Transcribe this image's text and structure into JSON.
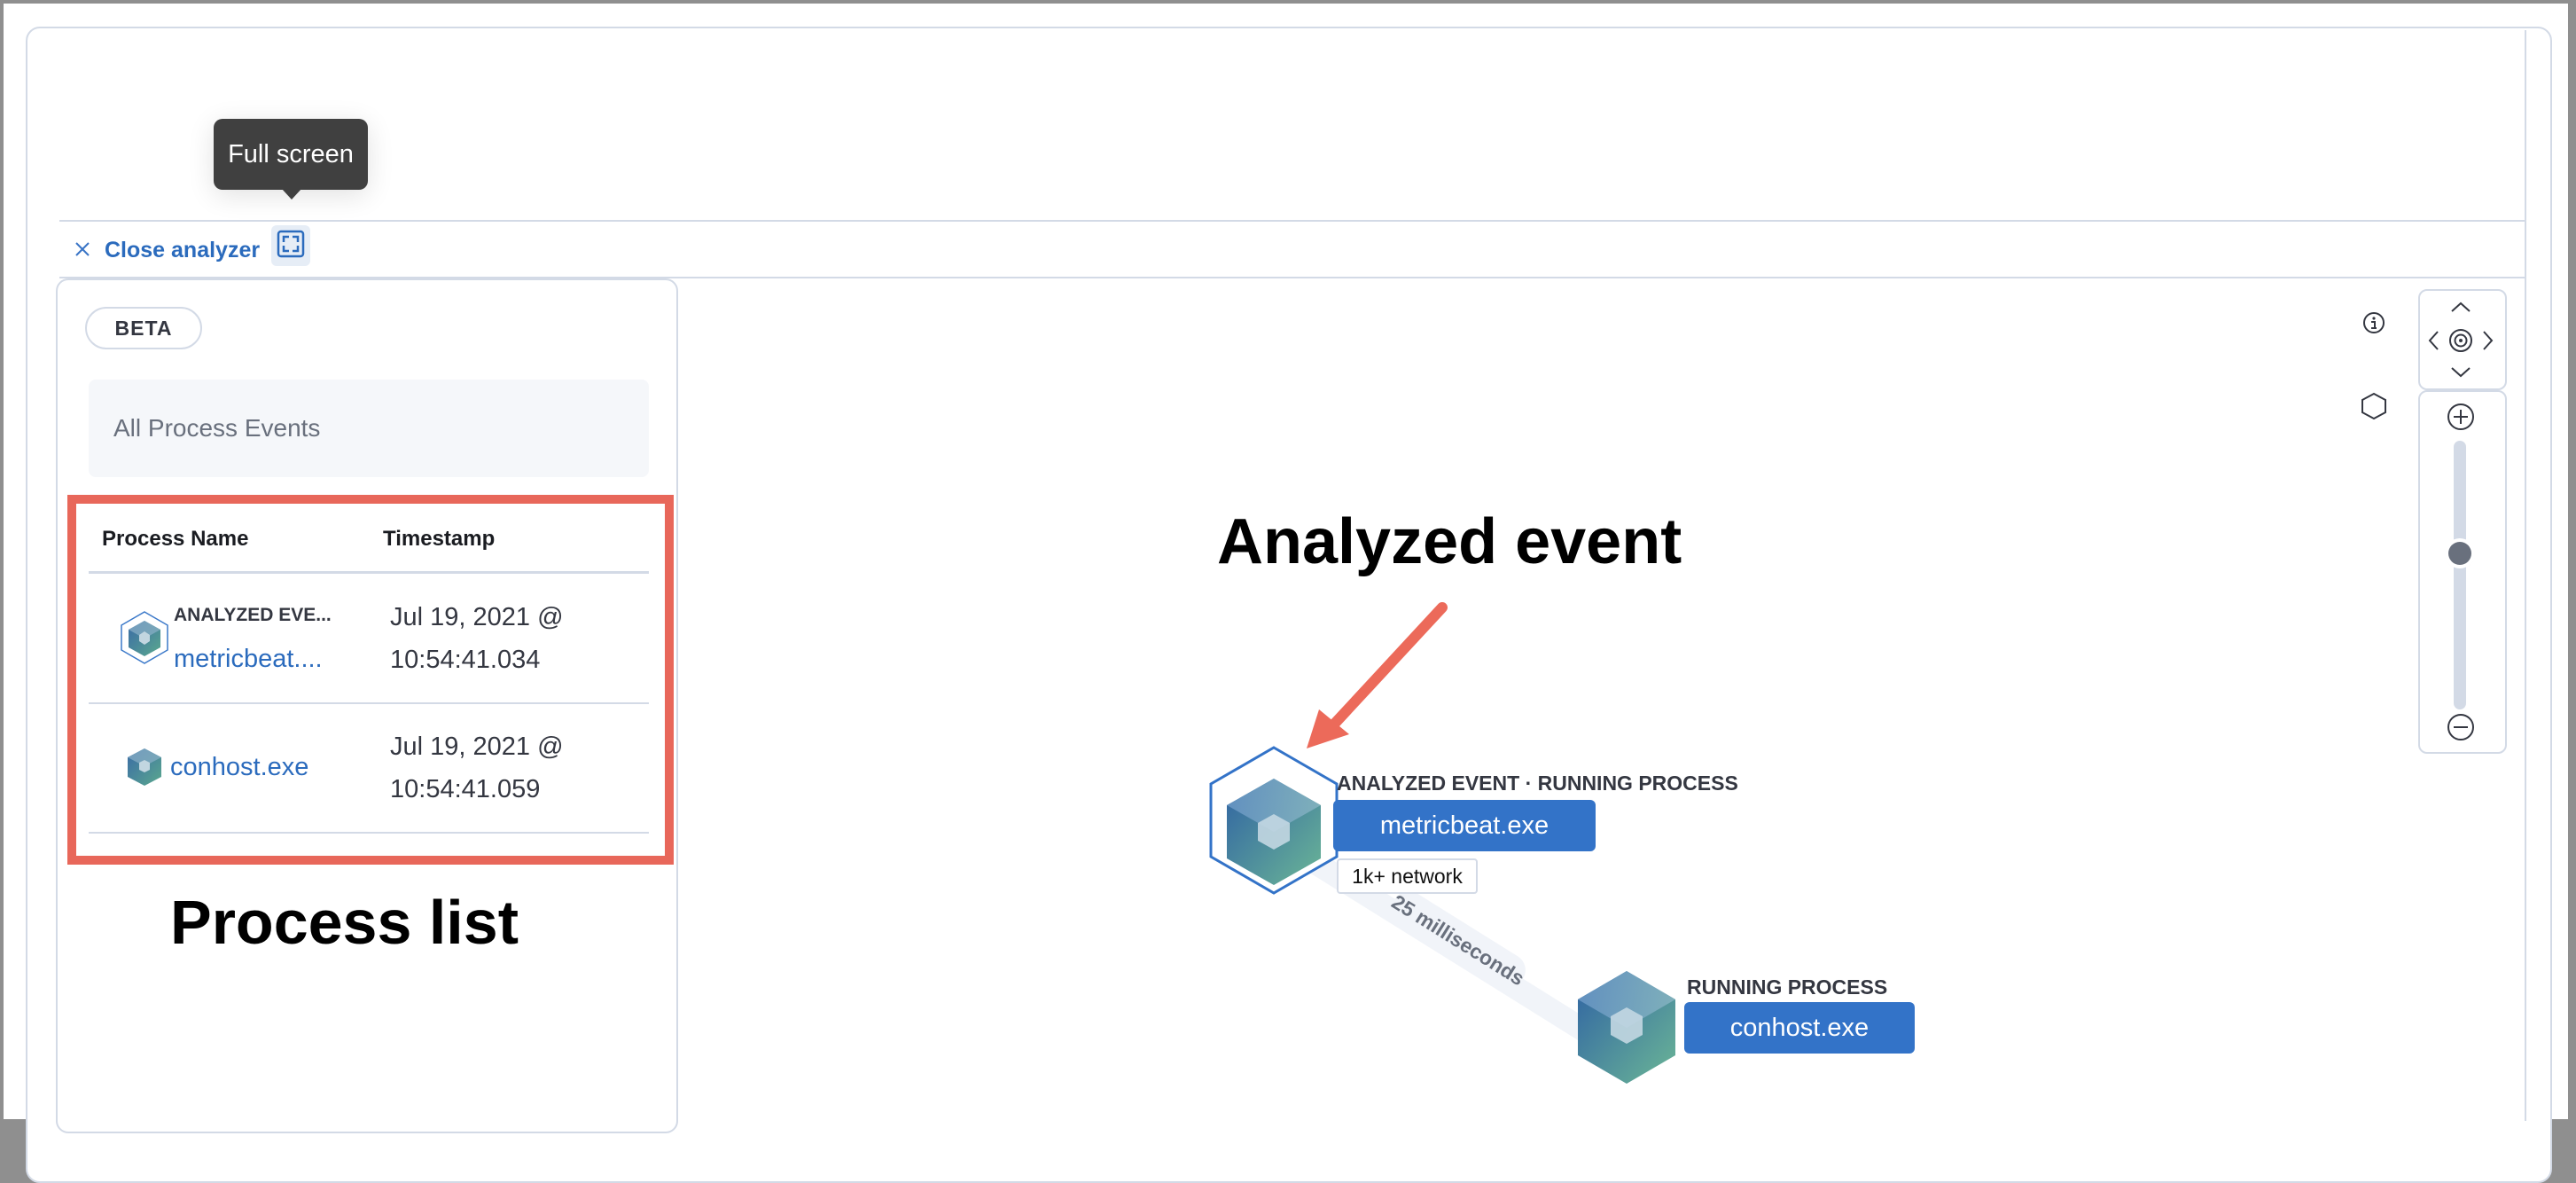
{
  "tooltip": {
    "text": "Full screen"
  },
  "toolbar": {
    "close_icon": "close-icon",
    "close_label": "Close analyzer",
    "fullscreen_icon": "fullscreen-icon"
  },
  "panel": {
    "badge": "BETA",
    "breadcrumb": "All Process Events",
    "table": {
      "columns": [
        "Process Name",
        "Timestamp"
      ],
      "rows": [
        {
          "tag": "ANALYZED EVE...",
          "name": "metricbeat....",
          "icon": "analyzed-process-cube-icon",
          "timestamp_date": "Jul 19, 2021 @",
          "timestamp_time": "10:54:41.034"
        },
        {
          "tag": "",
          "name": "conhost.exe",
          "icon": "process-cube-icon",
          "timestamp_date": "Jul 19, 2021 @",
          "timestamp_time": "10:54:41.059"
        }
      ]
    }
  },
  "annotations": {
    "process_list": "Process list",
    "analyzed_event": "Analyzed event",
    "highlight_color": "#E8675A"
  },
  "graph": {
    "nodes": [
      {
        "label": "ANALYZED EVENT · RUNNING PROCESS",
        "name": "metricbeat.exe",
        "badge": "1k+ network",
        "analyzed": true
      },
      {
        "label": "RUNNING PROCESS",
        "name": "conhost.exe",
        "analyzed": false
      }
    ],
    "edge": {
      "label": "25 milliseconds"
    },
    "node_button_color": "#3373C8"
  },
  "controls": {
    "info_icon": "info-icon",
    "schema_icon": "hexagon-icon",
    "pan": [
      "pan-up-icon",
      "pan-left-icon",
      "center-icon",
      "pan-right-icon",
      "pan-down-icon"
    ],
    "zoom_in_icon": "zoom-in-icon",
    "zoom_out_icon": "zoom-out-icon",
    "zoom_level_fraction": 0.58
  }
}
